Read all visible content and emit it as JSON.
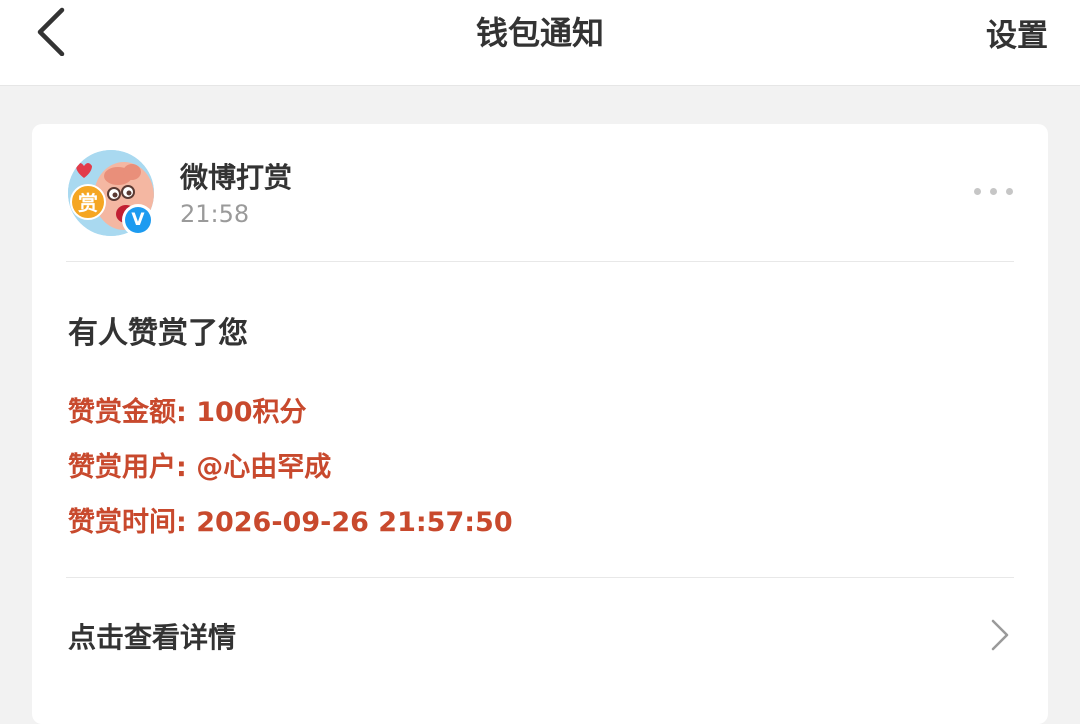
{
  "header": {
    "title": "钱包通知",
    "settings_label": "设置",
    "back_icon": "chevron-left-icon"
  },
  "notification": {
    "sender": {
      "name": "微博打赏",
      "time": "21:58",
      "avatar_text": "赏",
      "verified_mark": "V",
      "verified_color": "#1d9bf0"
    },
    "more_icon": "more-dots-icon",
    "title": "有人赞赏了您",
    "details": [
      {
        "label": "赞赏金额",
        "value": "100积分",
        "text": "赞赏金额: 100积分"
      },
      {
        "label": "赞赏用户",
        "value": "@心由罕成",
        "text": "赞赏用户: @心由罕成"
      },
      {
        "label": "赞赏时间",
        "value": "2026-09-26 21:57:50",
        "text": "赞赏时间: 2026-09-26 21:57:50"
      }
    ],
    "detail_color": "#c8492d",
    "view_detail_label": "点击查看详情",
    "view_detail_icon": "chevron-right-icon"
  }
}
